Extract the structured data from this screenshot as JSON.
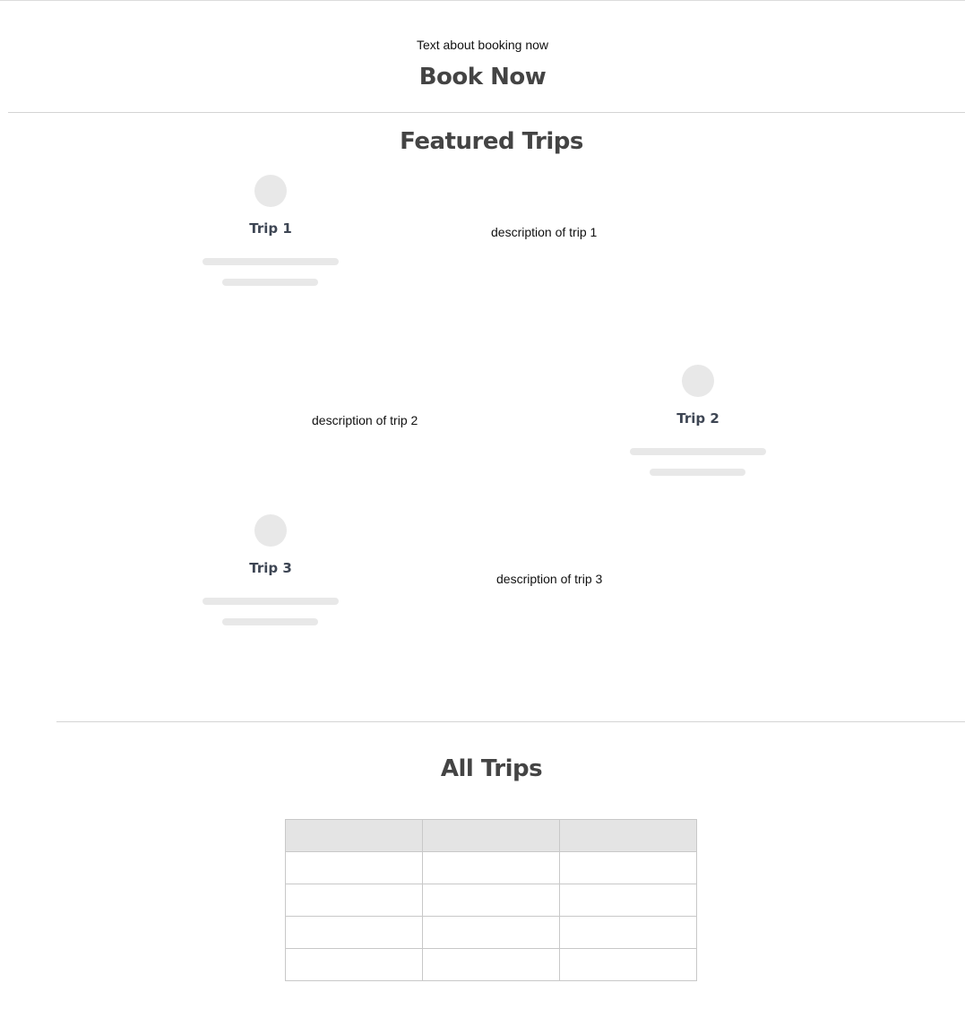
{
  "booking": {
    "text": "Text about booking now",
    "title": "Book Now"
  },
  "featured": {
    "title": "Featured Trips",
    "trips": [
      {
        "name": "Trip 1",
        "description": "description of trip 1"
      },
      {
        "name": "Trip 2",
        "description": "description of trip 2"
      },
      {
        "name": "Trip 3",
        "description": "description of trip 3"
      }
    ]
  },
  "all_trips": {
    "title": "All Trips",
    "table": {
      "headers": [
        "",
        "",
        ""
      ],
      "rows": [
        [
          "",
          "",
          ""
        ],
        [
          "",
          "",
          ""
        ],
        [
          "",
          "",
          ""
        ],
        [
          "",
          "",
          ""
        ]
      ]
    }
  },
  "colors": {
    "heading": "#444444",
    "trip_name": "#3d4553",
    "skeleton": "#e8e8e8",
    "table_header": "#e4e4e4",
    "rule": "#d4d4d4"
  }
}
